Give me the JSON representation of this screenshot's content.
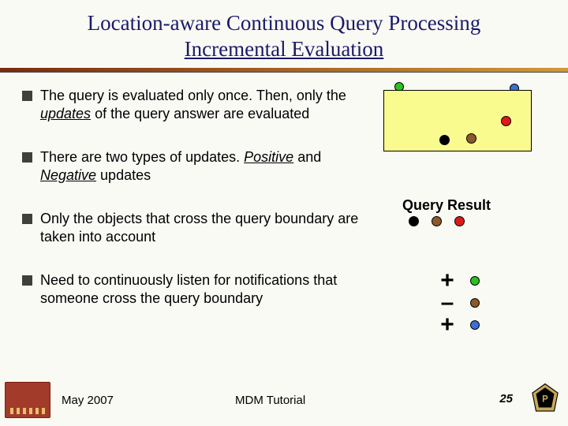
{
  "title": {
    "line1": "Location-aware Continuous Query Processing",
    "line2": "Incremental Evaluation"
  },
  "bullets": [
    {
      "pre": "The query is evaluated only once. Then, only the ",
      "emph": "updates",
      "post": " of the query answer are evaluated"
    },
    {
      "pre": "There are two types of updates. ",
      "emph1": "Positive",
      "mid": " and ",
      "emph2": "Negative",
      "post": " updates"
    },
    {
      "text": "Only the objects that cross the query boundary are taken into account"
    },
    {
      "text": "Need to continuously listen for notifications that someone cross the query boundary"
    }
  ],
  "query_result_label": "Query Result",
  "signs": {
    "plus": "+",
    "minus": "–"
  },
  "footer": {
    "date": "May 2007",
    "mid": "MDM Tutorial",
    "page": "25"
  }
}
